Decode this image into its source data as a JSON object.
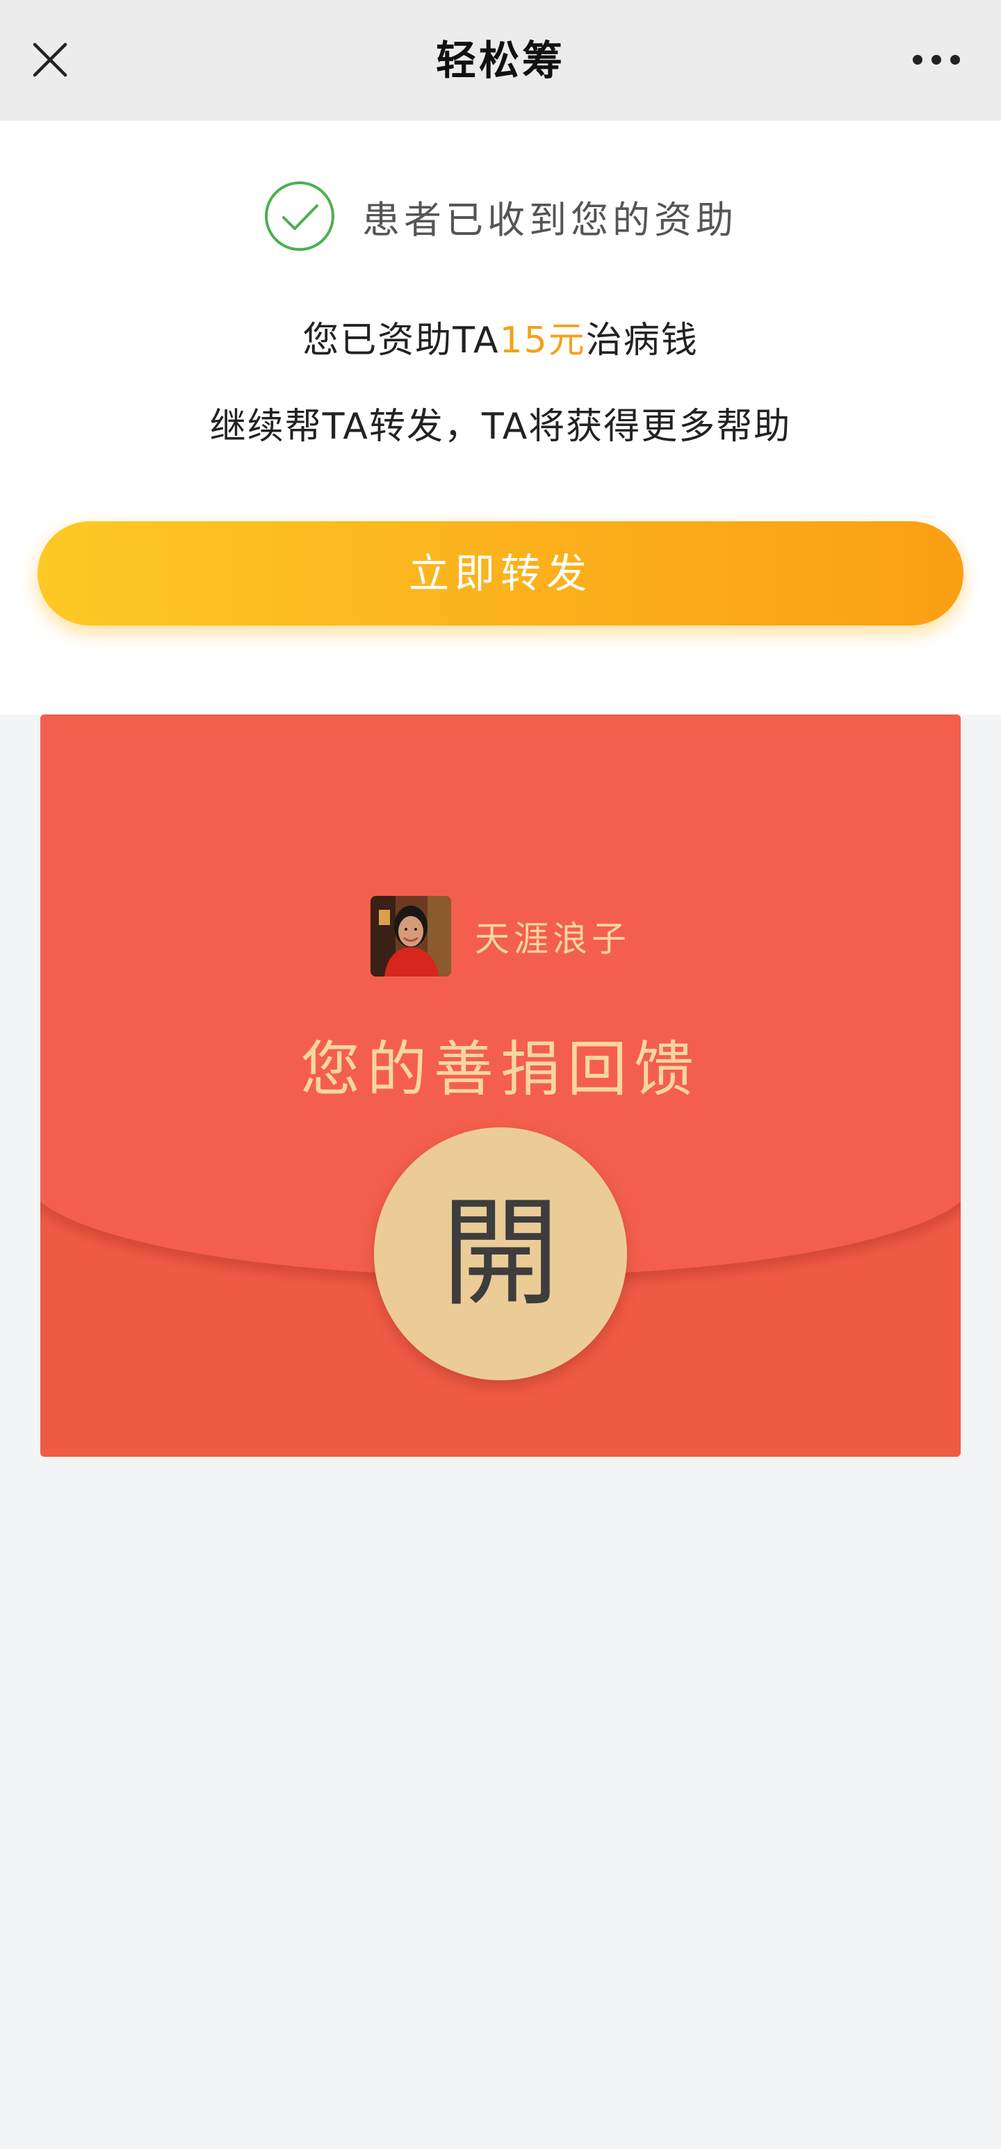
{
  "app": {
    "title": "轻松筹",
    "icons": {
      "close": "close-icon",
      "more": "more-horizontal-icon"
    }
  },
  "success": {
    "status_text": "患者已收到您的资助",
    "amount_prefix": "您已资助TA",
    "amount": "15元",
    "amount_suffix": "治病钱",
    "forward_tip": "继续帮TA转发，TA将获得更多帮助",
    "forward_button": "立即转发",
    "colors": {
      "success_green": "#4caf50",
      "amount_orange": "#f2a21d",
      "button_start": "#fdc925",
      "button_end": "#fb9f14"
    }
  },
  "red_packet": {
    "sender_name": "天涯浪子",
    "title": "您的善捐回馈",
    "open_label": "開",
    "colors": {
      "packet_red": "#ef5a45",
      "text_gold": "#f7d69f",
      "button_gold": "#ebcc97"
    }
  }
}
